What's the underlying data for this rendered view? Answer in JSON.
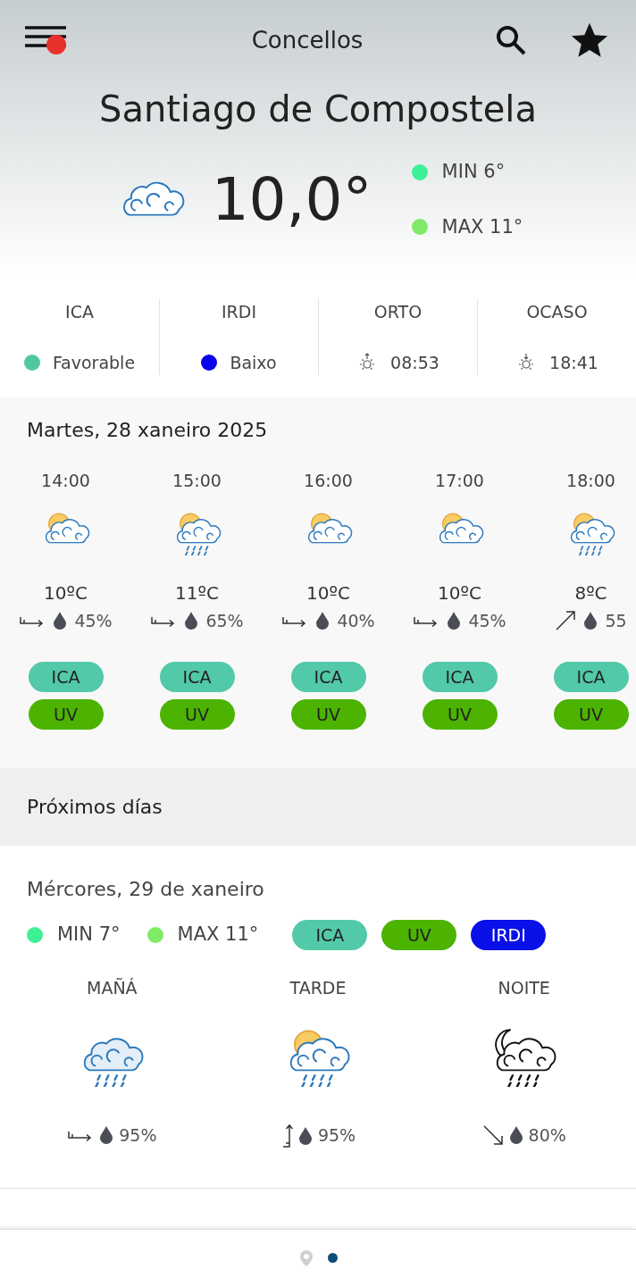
{
  "header": {
    "title": "Concellos"
  },
  "location": "Santiago de Compostela",
  "current": {
    "temperature": "10,0°",
    "min": {
      "label": "MIN 6°",
      "color": "#3cf095"
    },
    "max": {
      "label": "MAX 11°",
      "color": "#80ea66"
    }
  },
  "indices": [
    {
      "kind": "dot",
      "label": "ICA",
      "value": "Favorable",
      "color": "#4fc8a2"
    },
    {
      "kind": "dot",
      "label": "IRDI",
      "value": "Baixo",
      "color": "#0a00e8"
    },
    {
      "kind": "sunrise",
      "label": "ORTO",
      "value": "08:53"
    },
    {
      "kind": "sunset",
      "label": "OCASO",
      "value": "18:41"
    }
  ],
  "today": {
    "date": "Martes, 28 xaneiro 2025",
    "hours": [
      {
        "time": "14:00",
        "temperature": "10ºC",
        "rain": "45%",
        "pills": [
          {
            "label": "ICA",
            "color": "#52c9a8"
          },
          {
            "label": "UV",
            "color": "#4cb300"
          }
        ]
      },
      {
        "time": "15:00",
        "temperature": "11ºC",
        "rain": "65%",
        "pills": [
          {
            "label": "ICA",
            "color": "#52c9a8"
          },
          {
            "label": "UV",
            "color": "#4cb300"
          }
        ]
      },
      {
        "time": "16:00",
        "temperature": "10ºC",
        "rain": "40%",
        "pills": [
          {
            "label": "ICA",
            "color": "#52c9a8"
          },
          {
            "label": "UV",
            "color": "#4cb300"
          }
        ]
      },
      {
        "time": "17:00",
        "temperature": "10ºC",
        "rain": "45%",
        "pills": [
          {
            "label": "ICA",
            "color": "#52c9a8"
          },
          {
            "label": "UV",
            "color": "#4cb300"
          }
        ]
      },
      {
        "time": "18:00",
        "temperature": "8ºC",
        "rain": "55",
        "pills": [
          {
            "label": "ICA",
            "color": "#52c9a8"
          },
          {
            "label": "UV",
            "color": "#4cb300"
          }
        ]
      }
    ]
  },
  "next_days_title": "Próximos días",
  "days": [
    {
      "date": "Mércores, 29 de xaneiro",
      "min": {
        "label": "MIN 7°",
        "color": "#3cf095"
      },
      "max": {
        "label": "MAX 11°",
        "color": "#80ea66"
      },
      "pills": [
        {
          "label": "ICA",
          "color": "#52c9a8",
          "dark_text": true
        },
        {
          "label": "UV",
          "color": "#4cb300",
          "dark_text": true
        },
        {
          "label": "IRDI",
          "color": "#0a10e8",
          "dark_text": false
        }
      ],
      "periods": [
        {
          "label": "MAÑÁ",
          "rain": "95%"
        },
        {
          "label": "TARDE",
          "rain": "95%"
        },
        {
          "label": "NOITE",
          "rain": "80%"
        }
      ]
    }
  ],
  "pager": [
    {
      "kind": "location",
      "selected": false
    },
    {
      "kind": "dot",
      "selected": true
    }
  ]
}
